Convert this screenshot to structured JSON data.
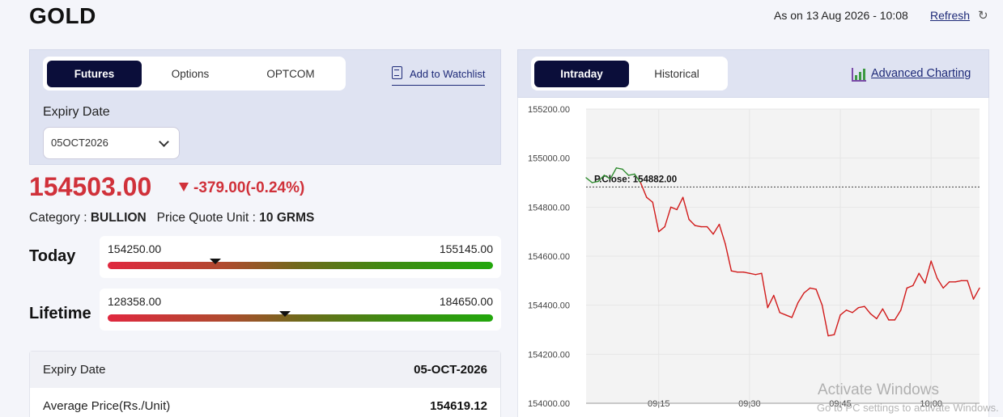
{
  "header": {
    "title": "GOLD",
    "as_on": "As on 13 Aug 2026 - 10:08",
    "refresh_label": "Refresh"
  },
  "contract": {
    "tabs": [
      {
        "label": "Futures",
        "active": true
      },
      {
        "label": "Options",
        "active": false
      },
      {
        "label": "OPTCOM",
        "active": false
      }
    ],
    "watchlist_label": "Add to Watchlist",
    "expiry_label": "Expiry Date",
    "expiry_selected": "05OCT2026"
  },
  "quote": {
    "price": "154503.00",
    "change": "-379.00(-0.24%)",
    "category_label": "Category :",
    "category_value": "BULLION",
    "unit_label": "Price Quote Unit :",
    "unit_value": "10 GRMS"
  },
  "ranges": {
    "today": {
      "label": "Today",
      "low": "154250.00",
      "high": "155145.00",
      "marker_fraction": 0.28
    },
    "lifetime": {
      "label": "Lifetime",
      "low": "128358.00",
      "high": "184650.00",
      "marker_fraction": 0.46
    }
  },
  "details": [
    {
      "key": "Expiry Date",
      "value": "05-OCT-2026"
    },
    {
      "key": "Average Price(Rs./Unit)",
      "value": "154619.12"
    }
  ],
  "chart_panel": {
    "tabs": [
      {
        "label": "Intraday",
        "active": true
      },
      {
        "label": "Historical",
        "active": false
      }
    ],
    "advanced_label": "Advanced Charting"
  },
  "chart_data": {
    "type": "line",
    "ylim": [
      154000,
      155200
    ],
    "yticks": [
      "155200.00",
      "155000.00",
      "154800.00",
      "154600.00",
      "154400.00",
      "154200.00",
      "154000.00"
    ],
    "xticks": [
      "09:15",
      "09:30",
      "09:45",
      "10:00"
    ],
    "prev_close": 154882,
    "prev_close_label": "P.Close: 154882.00",
    "series": [
      {
        "x": [
          "09:03",
          "09:04",
          "09:05",
          "09:06",
          "09:07",
          "09:08",
          "09:09",
          "09:10",
          "09:11",
          "09:12",
          "09:13",
          "09:14",
          "09:15",
          "09:16",
          "09:17",
          "09:18",
          "09:19",
          "09:20",
          "09:21",
          "09:22",
          "09:23",
          "09:24",
          "09:25",
          "09:26",
          "09:27",
          "09:28",
          "09:29",
          "09:30",
          "09:31",
          "09:32",
          "09:33",
          "09:34",
          "09:35",
          "09:36",
          "09:37",
          "09:38",
          "09:39",
          "09:40",
          "09:41",
          "09:42",
          "09:43",
          "09:44",
          "09:45",
          "09:46",
          "09:47",
          "09:48",
          "09:49",
          "09:50",
          "09:51",
          "09:52",
          "09:53",
          "09:54",
          "09:55",
          "09:56",
          "09:57",
          "09:58",
          "09:59",
          "10:00",
          "10:01",
          "10:02",
          "10:03",
          "10:04",
          "10:05",
          "10:06",
          "10:07",
          "10:08"
        ],
        "y": [
          154920,
          154900,
          154905,
          154930,
          154915,
          154960,
          154955,
          154930,
          154935,
          154900,
          154840,
          154820,
          154700,
          154720,
          154800,
          154790,
          154840,
          154750,
          154725,
          154720,
          154720,
          154690,
          154730,
          154650,
          154540,
          154535,
          154535,
          154530,
          154525,
          154530,
          154390,
          154440,
          154370,
          154360,
          154350,
          154410,
          154450,
          154470,
          154465,
          154400,
          154275,
          154280,
          154360,
          154380,
          154370,
          154390,
          154395,
          154365,
          154345,
          154385,
          154340,
          154340,
          154380,
          154470,
          154480,
          154530,
          154490,
          154580,
          154510,
          154470,
          154495,
          154495,
          154500,
          154500,
          154425,
          154470
        ],
        "color_above": "#2e8b2e",
        "color_below": "#d11a1a"
      }
    ],
    "grid": true
  },
  "overlay": {
    "watermark_title": "Activate Windows",
    "watermark_sub": "Go to PC settings to activate Windows."
  }
}
